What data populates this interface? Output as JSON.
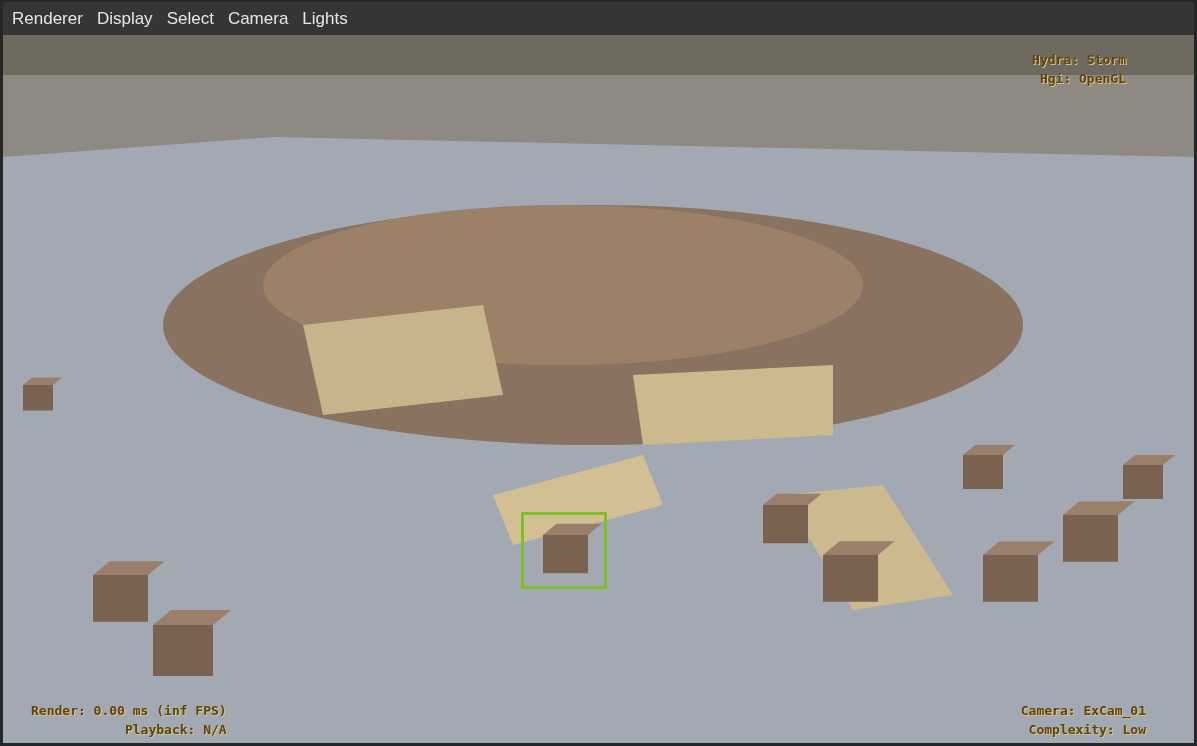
{
  "menu_bar": {
    "items": [
      "Renderer",
      "Display",
      "Select",
      "Camera",
      "Lights"
    ]
  },
  "viewport": {
    "kind": "picture",
    "hud_top_right": [
      "Hydra: Storm",
      "Hgi: OpenGL"
    ],
    "hud_bottom_left": [
      "Render: 0.00 ms (inf FPS)",
      "Playback: N/A"
    ],
    "hud_bottom_right": [
      "Camera: ExCam_01",
      "Complexity: Low"
    ],
    "selection": {
      "visible": true
    }
  }
}
